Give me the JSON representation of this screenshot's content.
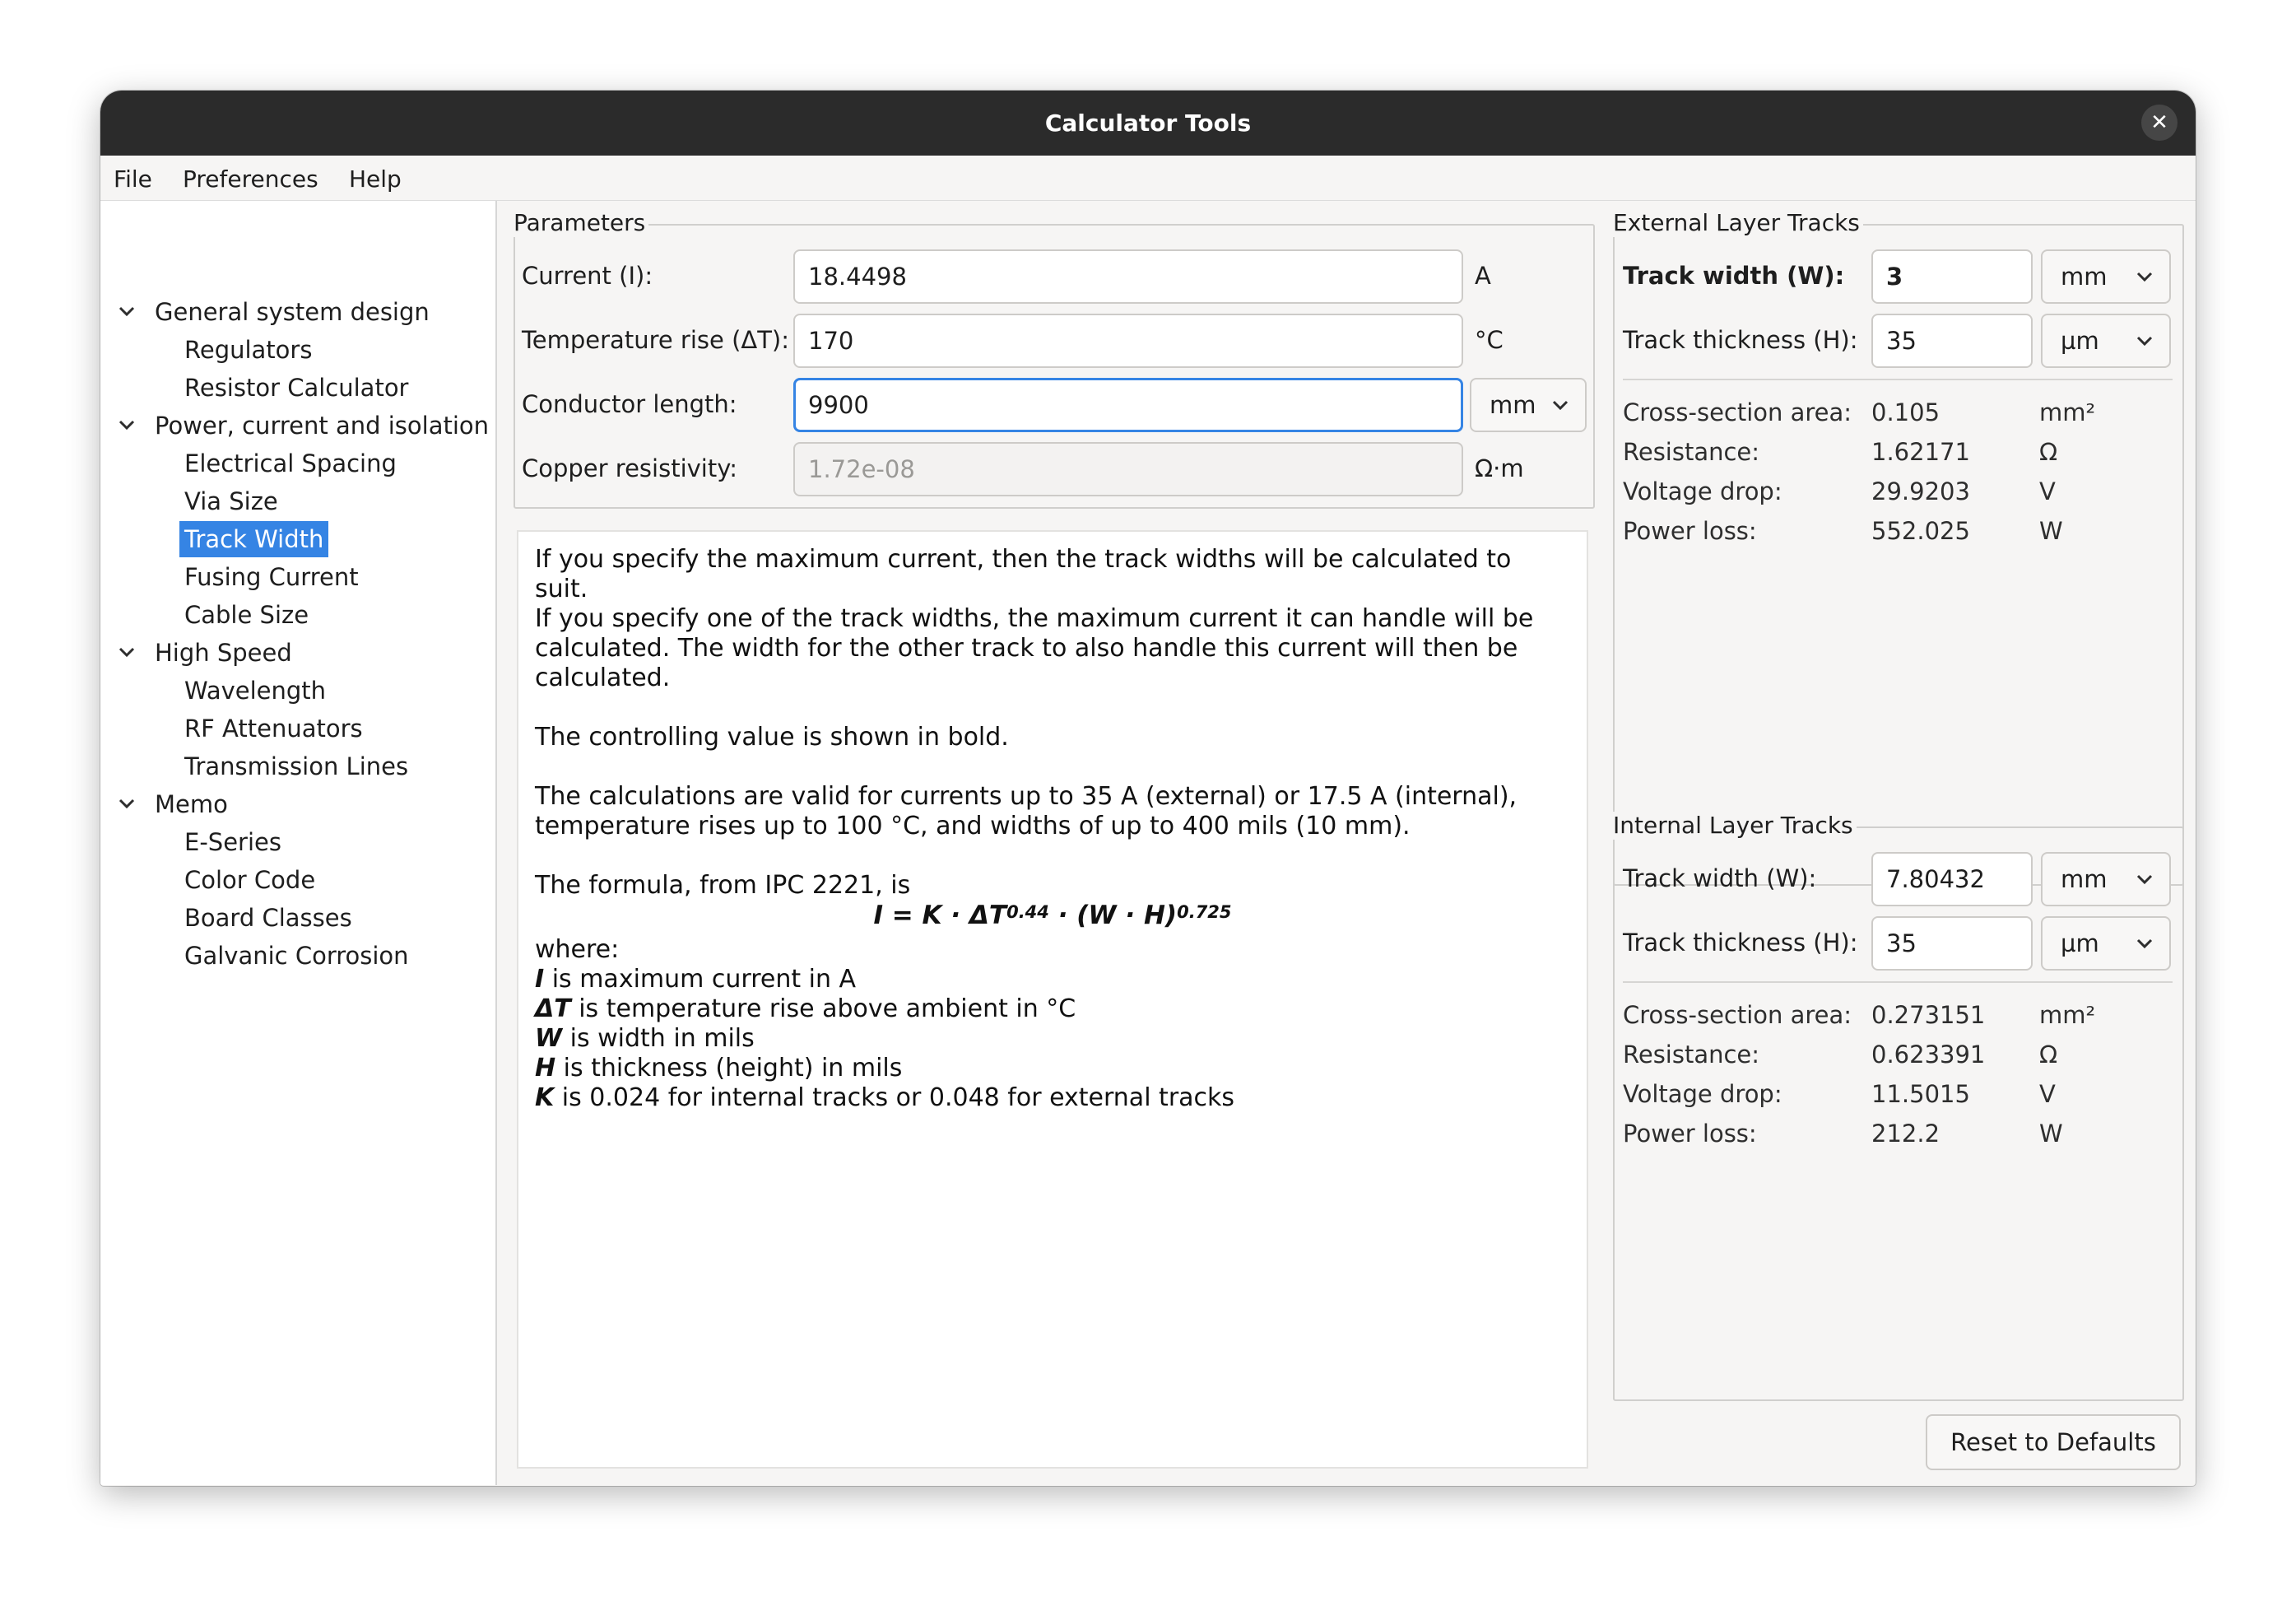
{
  "window": {
    "title": "Calculator Tools"
  },
  "menu": {
    "file": "File",
    "preferences": "Preferences",
    "help": "Help"
  },
  "tree": {
    "general": "General system design",
    "regulators": "Regulators",
    "resistor_calculator": "Resistor Calculator",
    "power": "Power, current and isolation",
    "electrical_spacing": "Electrical Spacing",
    "via_size": "Via Size",
    "track_width": "Track Width",
    "fusing_current": "Fusing Current",
    "cable_size": "Cable Size",
    "high_speed": "High Speed",
    "wavelength": "Wavelength",
    "rf_attenuators": "RF Attenuators",
    "transmission_lines": "Transmission Lines",
    "memo": "Memo",
    "e_series": "E-Series",
    "color_code": "Color Code",
    "board_classes": "Board Classes",
    "galvanic_corrosion": "Galvanic Corrosion"
  },
  "parameters": {
    "title": "Parameters",
    "current_label": "Current (I):",
    "current_value": "18.4498",
    "current_unit": "A",
    "temp_label": "Temperature rise (ΔT):",
    "temp_value": "170",
    "temp_unit": "°C",
    "length_label": "Conductor length:",
    "length_value": "9900",
    "length_unit": "mm",
    "resistivity_label": "Copper resistivity:",
    "resistivity_value": "1.72e-08",
    "resistivity_unit": "Ω·m"
  },
  "help": {
    "p1": "If you specify the maximum current, then the track widths will be calculated to suit.",
    "p2": "If you specify one of the track widths, the maximum current it can handle will be calculated. The width for the other track to also handle this current will then be calculated.",
    "p3": "The controlling value is shown in bold.",
    "p4": "The calculations are valid for currents up to 35 A (external) or 17.5 A (internal), temperature rises up to 100 °C, and widths of up to 400 mils (10 mm).",
    "p5": "The formula, from IPC 2221, is",
    "formula_main": "I = K · ΔT",
    "formula_exp1": "0.44",
    "formula_mid": " · (W · H)",
    "formula_exp2": "0.725",
    "where": "where:",
    "i_var": "I",
    "i_text": " is maximum current in A",
    "dt_var": "ΔT",
    "dt_text": " is temperature rise above ambient in °C",
    "w_var": "W",
    "w_text": " is width in mils",
    "h_var": "H",
    "h_text": " is thickness (height) in mils",
    "k_var": "K",
    "k_text": " is 0.024 for internal tracks or 0.048 for external tracks"
  },
  "external": {
    "title": "External Layer Tracks",
    "width_label": "Track width (W):",
    "width_value": "3",
    "width_unit": "mm",
    "thickness_label": "Track thickness (H):",
    "thickness_value": "35",
    "thickness_unit": "µm",
    "area_label": "Cross-section area:",
    "area_value": "0.105",
    "area_unit": "mm²",
    "resistance_label": "Resistance:",
    "resistance_value": "1.62171",
    "resistance_unit": "Ω",
    "vdrop_label": "Voltage drop:",
    "vdrop_value": "29.9203",
    "vdrop_unit": "V",
    "ploss_label": "Power loss:",
    "ploss_value": "552.025",
    "ploss_unit": "W"
  },
  "internal": {
    "title": "Internal Layer Tracks",
    "width_label": "Track width (W):",
    "width_value": "7.80432",
    "width_unit": "mm",
    "thickness_label": "Track thickness (H):",
    "thickness_value": "35",
    "thickness_unit": "µm",
    "area_label": "Cross-section area:",
    "area_value": "0.273151",
    "area_unit": "mm²",
    "resistance_label": "Resistance:",
    "resistance_value": "0.623391",
    "resistance_unit": "Ω",
    "vdrop_label": "Voltage drop:",
    "vdrop_value": "11.5015",
    "vdrop_unit": "V",
    "ploss_label": "Power loss:",
    "ploss_value": "212.2",
    "ploss_unit": "W"
  },
  "buttons": {
    "reset": "Reset to Defaults"
  },
  "colors": {
    "accent": "#3584e4",
    "titlebar": "#2b2b2b"
  }
}
